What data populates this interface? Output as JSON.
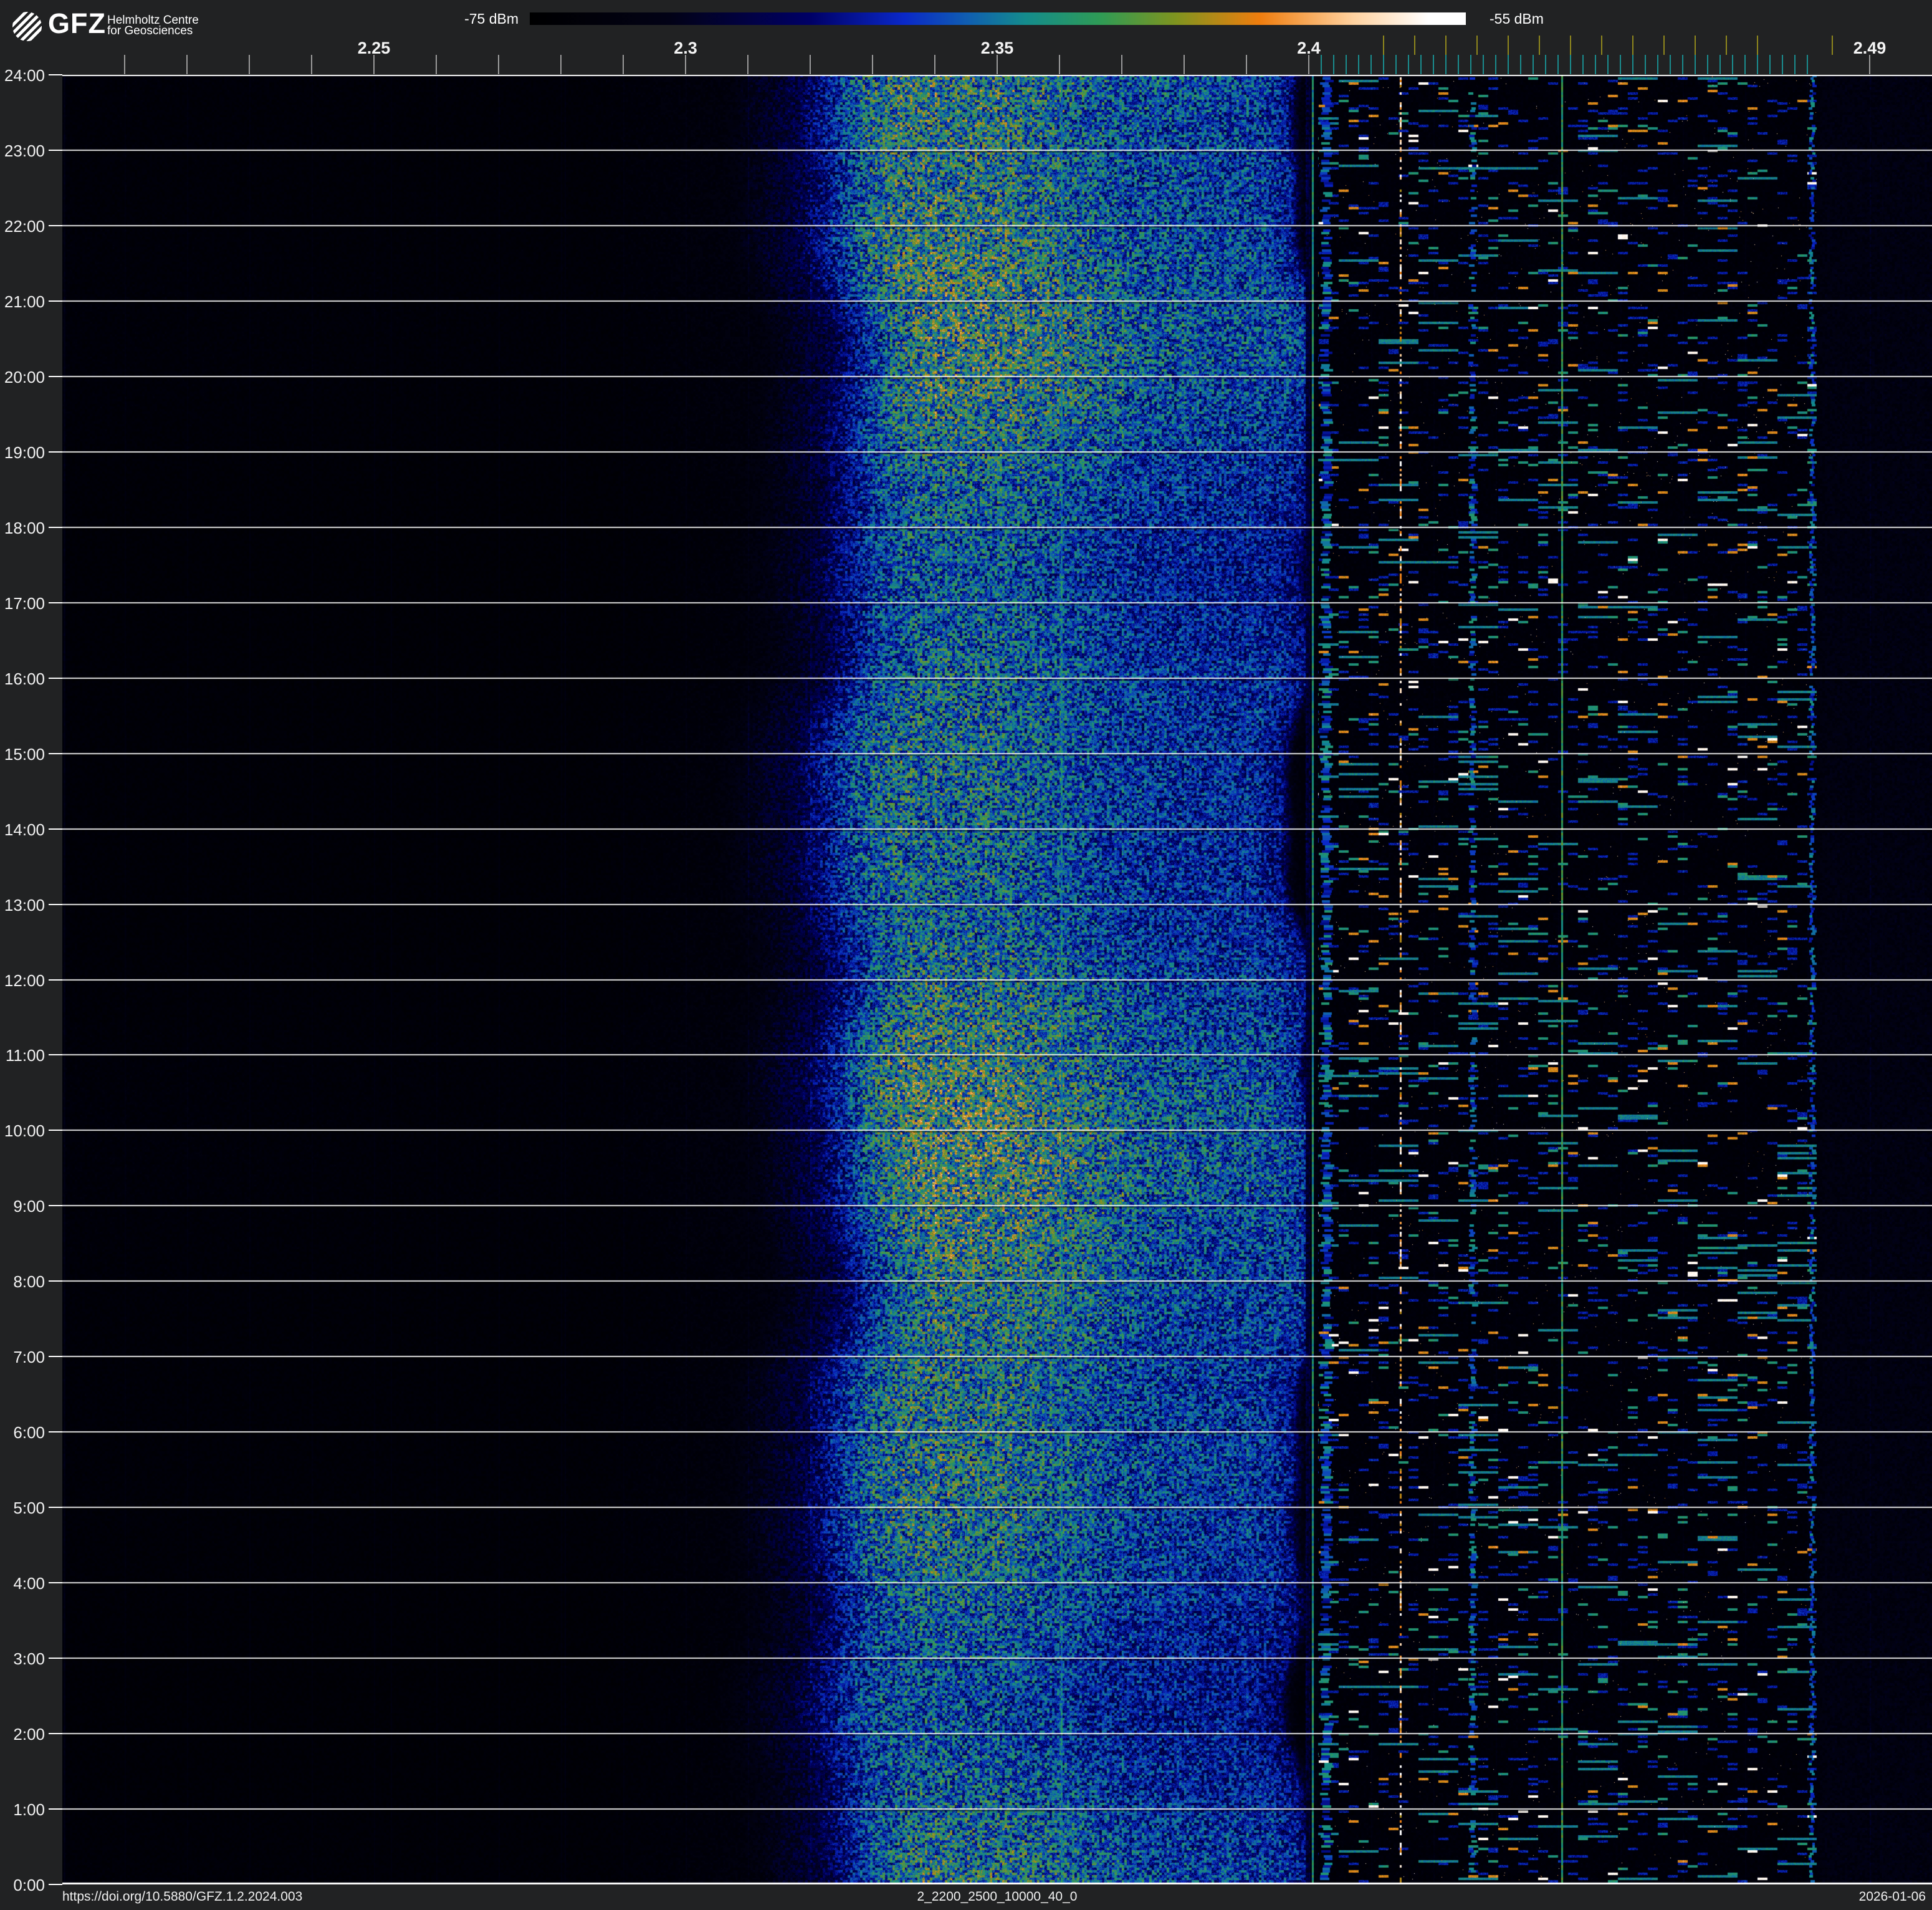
{
  "header": {
    "logo": {
      "brand": "GFZ",
      "line1": "Helmholtz Centre",
      "line2": "for Geosciences"
    },
    "colorbar": {
      "min_label": "-75 dBm",
      "max_label": "-55 dBm"
    }
  },
  "footer": {
    "doi": "https://doi.org/10.5880/GFZ.1.2.2024.003",
    "filename": "2_2200_2500_10000_40_0",
    "date": "2026-01-06"
  },
  "chart_data": {
    "type": "heatmap",
    "description": "24-hour radio-frequency power spectrogram, frequency horizontal, time of day vertical",
    "x_axis": {
      "unit": "GHz",
      "min": 2.2,
      "max": 2.5,
      "labeled_ticks": [
        {
          "label": "2.25",
          "f": 2.25
        },
        {
          "label": "2.3",
          "f": 2.3
        },
        {
          "label": "2.35",
          "f": 2.35
        },
        {
          "label": "2.4",
          "f": 2.4
        },
        {
          "label": "2.49",
          "f": 2.49
        }
      ],
      "minor_tick_step": 0.01,
      "minor_tick_min": 2.21,
      "minor_tick_max": 2.49
    },
    "y_axis": {
      "unit": "h",
      "min": 0,
      "max": 24,
      "tick_step": 1,
      "labels": [
        "24:00",
        "23:00",
        "22:00",
        "21:00",
        "20:00",
        "19:00",
        "18:00",
        "17:00",
        "16:00",
        "15:00",
        "14:00",
        "13:00",
        "12:00",
        "11:00",
        "10:00",
        "9:00",
        "8:00",
        "7:00",
        "6:00",
        "5:00",
        "4:00",
        "3:00",
        "2:00",
        "1:00",
        "0:00"
      ]
    },
    "colorbar": {
      "min_dbm": -75,
      "max_dbm": -55,
      "unit": "dBm"
    },
    "colormap_stops": [
      [
        0.0,
        "#000000"
      ],
      [
        0.15,
        "#020216"
      ],
      [
        0.3,
        "#000066"
      ],
      [
        0.4,
        "#0a28c8"
      ],
      [
        0.47,
        "#1060b0"
      ],
      [
        0.53,
        "#148c8c"
      ],
      [
        0.61,
        "#2f9b55"
      ],
      [
        0.69,
        "#7f941f"
      ],
      [
        0.78,
        "#ef7d0e"
      ],
      [
        0.88,
        "#ffd2a0"
      ],
      [
        0.96,
        "#ffffff"
      ],
      [
        1.0,
        "#ffffff"
      ]
    ],
    "channel_markers": {
      "ble": {
        "color": "#1a8c8e",
        "first_ghz": 2.402,
        "step_ghz": 0.002,
        "count": 40
      },
      "wifi": {
        "color": "#8f871d",
        "freqs_ghz": [
          2.412,
          2.417,
          2.422,
          2.427,
          2.432,
          2.437,
          2.442,
          2.447,
          2.452,
          2.457,
          2.462,
          2.467,
          2.472,
          2.484
        ]
      }
    },
    "band_profile": [
      [
        2.2,
        0.06
      ],
      [
        2.285,
        0.055
      ],
      [
        2.308,
        0.085
      ],
      [
        2.32,
        0.22
      ],
      [
        2.33,
        0.46
      ],
      [
        2.336,
        0.52
      ],
      [
        2.352,
        0.51
      ],
      [
        2.362,
        0.47
      ],
      [
        2.372,
        0.42
      ],
      [
        2.384,
        0.405
      ],
      [
        2.394,
        0.395
      ],
      [
        2.3985,
        0.33
      ],
      [
        2.4005,
        0.12
      ],
      [
        2.402,
        0.068
      ],
      [
        2.48,
        0.066
      ],
      [
        2.483,
        0.112
      ],
      [
        2.5,
        0.115
      ]
    ],
    "emitters": [
      {
        "f": 2.2003,
        "w": 3,
        "type": "noisy",
        "vmin": 0.1,
        "vmax": 0.16
      },
      {
        "f": 2.2528,
        "w": 2,
        "type": "noisy",
        "vmin": 0.07,
        "vmax": 0.12
      },
      {
        "f": 2.2807,
        "w": 2,
        "type": "noisy",
        "vmin": 0.08,
        "vmax": 0.14
      },
      {
        "f": 2.3603,
        "w": 3,
        "type": "noisy",
        "vmin": 0.42,
        "vmax": 0.6
      },
      {
        "f": 2.4006,
        "w": 3,
        "type": "noisy",
        "vmin": 0.48,
        "vmax": 0.64
      },
      {
        "f": 2.4028,
        "w": 12,
        "type": "blotchy",
        "prob": 0.78,
        "vmin": 0.32,
        "vmax": 0.58,
        "jitter": 4
      },
      {
        "f": 2.4147,
        "w": 3,
        "type": "dotted",
        "prob": 0.5,
        "vmin": 0.72,
        "vmax": 1.0
      },
      {
        "f": 2.4262,
        "w": 7,
        "type": "blotchy",
        "prob": 0.55,
        "vmin": 0.33,
        "vmax": 0.58,
        "jitter": 3
      },
      {
        "f": 2.4406,
        "w": 3,
        "type": "noisy",
        "vmin": 0.52,
        "vmax": 0.68
      },
      {
        "f": 2.4807,
        "w": 4,
        "type": "blotchy",
        "prob": 0.8,
        "vmin": 0.33,
        "vmax": 0.55,
        "jitter": 3
      },
      {
        "f": 2.4921,
        "w": 2,
        "type": "noisy",
        "vmin": 0.1,
        "vmax": 0.16
      }
    ],
    "speckle_zone": {
      "range_ghz": [
        2.4015,
        2.4815
      ],
      "dash_prob": 0.09,
      "dash_palette": {
        "blue": 0.6,
        "teal": 0.24,
        "orange": 0.1,
        "white": 0.06
      }
    },
    "grid": {
      "hour_line_color": "rgba(255,255,255,0.88)",
      "faint_freq_grid_step_ghz": 0.01
    }
  }
}
